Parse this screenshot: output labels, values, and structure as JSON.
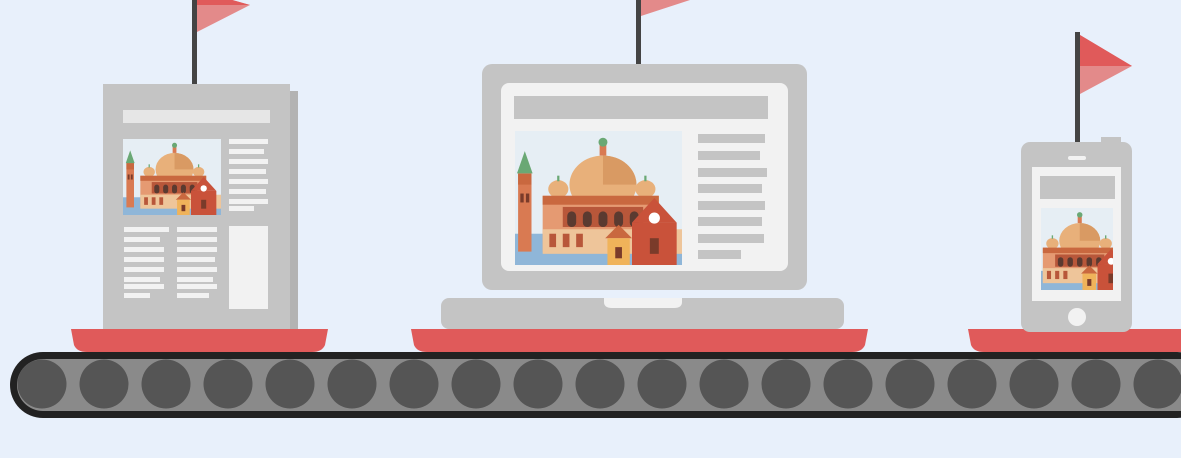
{
  "colors": {
    "background": "#e8f0fb",
    "flag_red": "#e05a5a",
    "flag_pink": "#e38a8a",
    "pole": "#444444",
    "device_gray": "#c4c4c4",
    "device_screen": "#f2f2f2",
    "platform_red": "#e05a5a",
    "belt_dark": "#222222",
    "belt_mid": "#8a8a8a",
    "roller": "#555555"
  },
  "scene": {
    "items": [
      {
        "name": "newspaper",
        "icon": "newspaper-icon"
      },
      {
        "name": "laptop",
        "icon": "laptop-icon"
      },
      {
        "name": "smartphone",
        "icon": "smartphone-icon"
      }
    ],
    "illustration_subject": "venice-cityscape-icon"
  }
}
